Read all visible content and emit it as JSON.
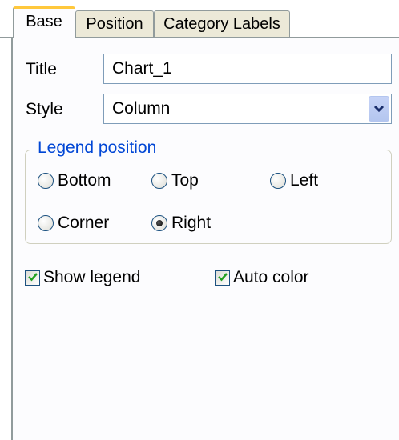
{
  "tabs": [
    {
      "label": "Base",
      "active": true
    },
    {
      "label": "Position",
      "active": false
    },
    {
      "label": "Category Labels",
      "active": false
    }
  ],
  "form": {
    "title_label": "Title",
    "title_value": "Chart_1",
    "style_label": "Style",
    "style_value": "Column"
  },
  "legend_position": {
    "group_title": "Legend position",
    "options": [
      "Bottom",
      "Top",
      "Left",
      "Corner",
      "Right"
    ],
    "selected": "Right"
  },
  "checks": {
    "show_legend": {
      "label": "Show legend",
      "checked": true
    },
    "auto_color": {
      "label": "Auto color",
      "checked": true
    }
  },
  "icons": {
    "dropdown": "chevron-down-icon",
    "check": "checkmark-icon"
  },
  "colors": {
    "active_tab_accent": "#ffc83c",
    "group_title": "#0046d5",
    "panel_bg": "#fcfcfe"
  }
}
